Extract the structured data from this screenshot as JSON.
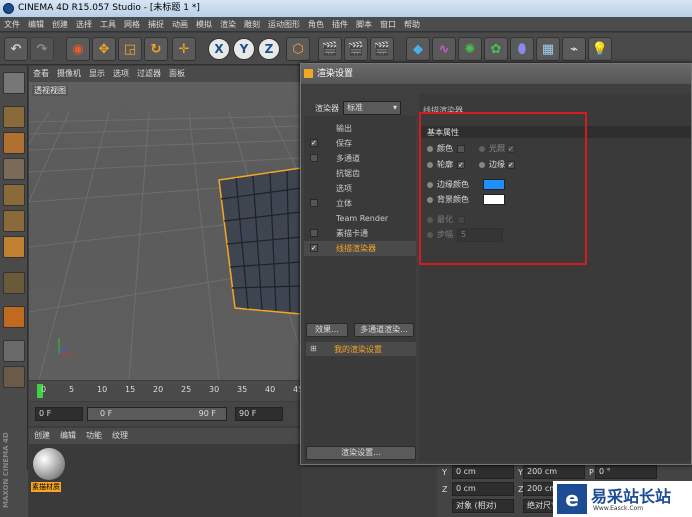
{
  "window": {
    "title": "CINEMA 4D R15.057 Studio - [未标题 1 *]"
  },
  "menubar": [
    "文件",
    "编辑",
    "创建",
    "选择",
    "工具",
    "网格",
    "捕捉",
    "动画",
    "模拟",
    "渲染",
    "雕刻",
    "运动图形",
    "角色",
    "插件",
    "脚本",
    "窗口",
    "帮助"
  ],
  "toolbar": {
    "axis_x": "X",
    "axis_y": "Y",
    "axis_z": "Z"
  },
  "viewport": {
    "menu": [
      "查看",
      "摄像机",
      "显示",
      "选项",
      "过滤器",
      "面板"
    ],
    "label": "透视视图"
  },
  "timeline": {
    "ticks": [
      "0",
      "5",
      "10",
      "15",
      "20",
      "25",
      "30",
      "35",
      "40",
      "45"
    ]
  },
  "transport": {
    "start": "0 F",
    "current": "0 F",
    "end_a": "90 F",
    "end_b": "90 F"
  },
  "material_panel": {
    "menu": [
      "创建",
      "编辑",
      "功能",
      "纹理"
    ],
    "material_name": "素描材质"
  },
  "brand": {
    "maxon": "MAXON",
    "cinema": "CINEMA 4D"
  },
  "coords": {
    "row1": {
      "x_label": "Y",
      "x_value": "0 cm",
      "size_label": "Y",
      "size_value": "200 cm",
      "rot_label": "P",
      "rot_value": "0 °"
    },
    "row2": {
      "x_label": "Z",
      "x_value": "0 cm",
      "size_label": "Z",
      "size_value": "200 cm"
    },
    "mode_dropdown": "对象 (相对)",
    "size_dropdown": "绝对尺寸"
  },
  "dialog": {
    "title": "渲染设置",
    "renderer_label": "渲染器",
    "renderer_value": "标准",
    "nav": [
      {
        "label": "输出",
        "checkable": false,
        "checked": false
      },
      {
        "label": "保存",
        "checkable": true,
        "checked": true
      },
      {
        "label": "多通道",
        "checkable": true,
        "checked": false
      },
      {
        "label": "抗锯齿",
        "checkable": false,
        "checked": false
      },
      {
        "label": "选项",
        "checkable": false,
        "checked": false
      },
      {
        "label": "立体",
        "checkable": true,
        "checked": false
      },
      {
        "label": "Team Render",
        "checkable": false,
        "checked": false
      },
      {
        "label": "素描卡通",
        "checkable": true,
        "checked": false
      },
      {
        "label": "线描渲染器",
        "checkable": true,
        "checked": true,
        "active": true
      }
    ],
    "effects_button": "效果...",
    "multipass_button": "多通道渲染...",
    "preset_label": "我的渲染设置",
    "render_settings_button": "渲染设置...",
    "section_header": "线描渲染器",
    "basic_props": "基本属性",
    "props": {
      "color": {
        "label": "颜色",
        "checked": false
      },
      "shading": {
        "label": "光照",
        "checked": true
      },
      "outline": {
        "label": "轮廓",
        "checked": true
      },
      "edges": {
        "label": "边缘",
        "checked": true
      },
      "edge_color": {
        "label": "边缘颜色",
        "color": "#1e90ff"
      },
      "bg_color": {
        "label": "背景颜色",
        "color": "#ffffff"
      },
      "smooth": {
        "label": "最化",
        "checked": false
      },
      "steps": {
        "label": "步幅",
        "value": "5"
      }
    }
  },
  "watermark": {
    "text": "易采站长站",
    "sub": "Www.Easck.Com"
  },
  "colors": {
    "accent_orange": "#f5a623",
    "highlight_red": "#d41c1c",
    "edge_blue": "#1e90ff"
  }
}
